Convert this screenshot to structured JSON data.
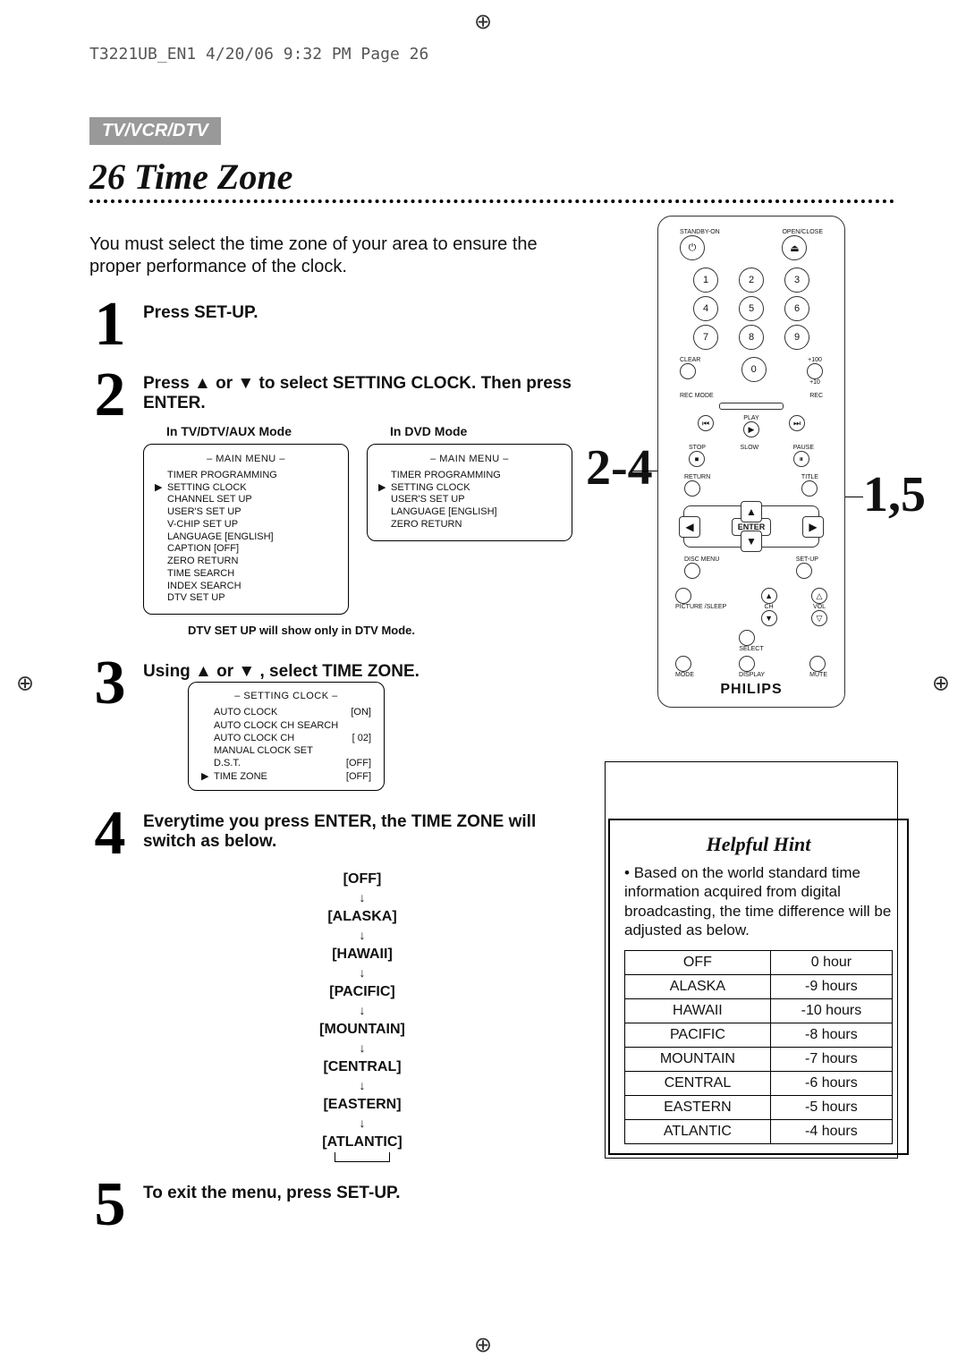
{
  "pageInfo": "T3221UB_EN1  4/20/06  9:32 PM  Page 26",
  "sectionTag": "TV/VCR/DTV",
  "pageNumber": "26",
  "title": "Time Zone",
  "intro": "You must select the time zone of your area to ensure the proper performance of the clock.",
  "steps": {
    "s1": {
      "title": "Press SET-UP."
    },
    "s2": {
      "title": "Press ▲ or ▼ to select SETTING CLOCK. Then press ENTER.",
      "modeTV": "In TV/DTV/AUX Mode",
      "modeDVD": "In DVD Mode",
      "dtvNote": "DTV SET UP will show only in DTV Mode."
    },
    "s3": {
      "title": "Using ▲ or ▼ , select TIME ZONE."
    },
    "s4": {
      "title": "Everytime you press ENTER, the TIME ZONE will switch as below."
    },
    "s5": {
      "title": "To exit the menu, press SET-UP."
    }
  },
  "mainMenuTV": {
    "header": "– MAIN MENU –",
    "items": [
      "TIMER PROGRAMMING",
      "SETTING CLOCK",
      "CHANNEL SET UP",
      "USER'S SET UP",
      "V-CHIP SET UP",
      "LANGUAGE  [ENGLISH]",
      "CAPTION  [OFF]",
      "ZERO RETURN",
      "TIME SEARCH",
      "INDEX SEARCH",
      "DTV SET UP"
    ],
    "pointerIndex": 1
  },
  "mainMenuDVD": {
    "header": "– MAIN MENU –",
    "items": [
      "TIMER PROGRAMMING",
      "SETTING CLOCK",
      "USER'S SET UP",
      "LANGUAGE  [ENGLISH]",
      "ZERO RETURN"
    ],
    "pointerIndex": 1
  },
  "settingClock": {
    "header": "– SETTING CLOCK –",
    "items": [
      {
        "label": "AUTO CLOCK",
        "value": "[ON]"
      },
      {
        "label": "AUTO CLOCK CH SEARCH",
        "value": ""
      },
      {
        "label": "AUTO CLOCK CH",
        "value": "[  02]"
      },
      {
        "label": "MANUAL CLOCK SET",
        "value": ""
      },
      {
        "label": "D.S.T.",
        "value": "[OFF]"
      },
      {
        "label": "TIME ZONE",
        "value": "[OFF]"
      }
    ],
    "pointerIndex": 5
  },
  "tzSequence": [
    "[OFF]",
    "[ALASKA]",
    "[HAWAII]",
    "[PACIFIC]",
    "[MOUNTAIN]",
    "[CENTRAL]",
    "[EASTERN]",
    "[ATLANTIC]"
  ],
  "callouts": {
    "left": "2-4",
    "right": "1,5"
  },
  "remote": {
    "topLeft": "STANDBY-ON",
    "topRight": "OPEN/CLOSE",
    "numbers": [
      "1",
      "2",
      "3",
      "4",
      "5",
      "6",
      "7",
      "8",
      "9",
      "0"
    ],
    "clear": "CLEAR",
    "p100": "+100",
    "p10": "+10",
    "recMode": "REC MODE",
    "rec": "REC",
    "play": "PLAY",
    "stop": "STOP",
    "slow": "SLOW",
    "pause": "PAUSE",
    "return": "RETURN",
    "title": "TITLE",
    "enter": "ENTER",
    "disc": "DISC\nMENU",
    "setup": "SET-UP",
    "picture": "PICTURE\n/SLEEP",
    "ch": "CH",
    "vol": "VOL",
    "select": "SELECT",
    "mode": "MODE",
    "display": "DISPLAY",
    "mute": "MUTE",
    "brand": "PHILIPS"
  },
  "hint": {
    "title": "Helpful Hint",
    "text": "Based on the world standard time information acquired from digital broadcasting, the time difference will be adjusted as below.",
    "table": [
      [
        "OFF",
        "0 hour"
      ],
      [
        "ALASKA",
        "-9 hours"
      ],
      [
        "HAWAII",
        "-10 hours"
      ],
      [
        "PACIFIC",
        "-8 hours"
      ],
      [
        "MOUNTAIN",
        "-7 hours"
      ],
      [
        "CENTRAL",
        "-6 hours"
      ],
      [
        "EASTERN",
        "-5 hours"
      ],
      [
        "ATLANTIC",
        "-4 hours"
      ]
    ]
  }
}
